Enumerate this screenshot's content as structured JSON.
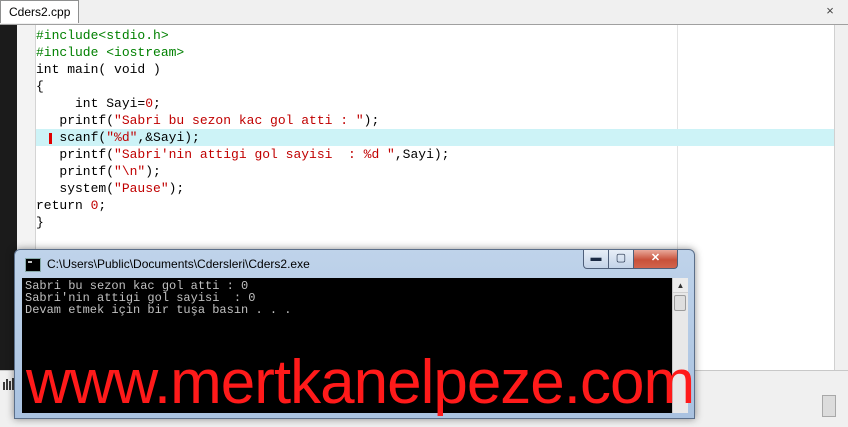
{
  "tabs": [
    {
      "label": "Cders2.cpp"
    }
  ],
  "tab_close_icon": "×",
  "editor": {
    "lines": [
      [
        {
          "t": "#include<stdio.h>",
          "c": "pp"
        }
      ],
      [
        {
          "t": "#include <iostream>",
          "c": "pp"
        }
      ],
      [
        {
          "t": "int main( void )",
          "c": "kw"
        }
      ],
      [
        {
          "t": "{",
          "c": "kw"
        }
      ],
      [
        {
          "t": "     int Sayi=",
          "c": "kw"
        },
        {
          "t": "0",
          "c": "num"
        },
        {
          "t": ";",
          "c": "kw"
        }
      ],
      [
        {
          "t": "   printf(",
          "c": "kw"
        },
        {
          "t": "\"Sabri bu sezon kac gol atti : \"",
          "c": "str"
        },
        {
          "t": ");",
          "c": "kw"
        }
      ],
      [
        {
          "t": "   scanf(",
          "c": "kw"
        },
        {
          "t": "\"%d\"",
          "c": "str"
        },
        {
          "t": ",&Sayi);",
          "c": "kw"
        }
      ],
      [
        {
          "t": "   printf(",
          "c": "kw"
        },
        {
          "t": "\"Sabri'nin attigi gol sayisi  : %d \"",
          "c": "str"
        },
        {
          "t": ",Sayi);",
          "c": "kw"
        }
      ],
      [
        {
          "t": "   printf(",
          "c": "kw"
        },
        {
          "t": "\"\\n\"",
          "c": "str"
        },
        {
          "t": ");",
          "c": "kw"
        }
      ],
      [
        {
          "t": "   system(",
          "c": "kw"
        },
        {
          "t": "\"Pause\"",
          "c": "str"
        },
        {
          "t": ");",
          "c": "kw"
        }
      ],
      [
        {
          "t": "return ",
          "c": "kw"
        },
        {
          "t": "0",
          "c": "num"
        },
        {
          "t": ";",
          "c": "kw"
        }
      ],
      [
        {
          "t": "}",
          "c": "kw"
        }
      ]
    ],
    "highlighted_line": 6
  },
  "console": {
    "title": "C:\\Users\\Public\\Documents\\Cdersleri\\Cders2.exe",
    "minimize_label": "▬",
    "maximize_label": "▢",
    "close_label": "✕",
    "scroll_up": "▲",
    "lines": [
      "Sabri bu sezon kac gol atti : 0",
      "Sabri'nin attigi gol sayisi  : 0",
      "Devam etmek için bir tuşa basın . . ."
    ]
  },
  "watermark": "www.mertkanelpeze.com",
  "colors": {
    "preprocessor": "#008000",
    "string": "#c00000",
    "highlight": "#cdf3f7",
    "watermark": "#ff1a1a"
  }
}
